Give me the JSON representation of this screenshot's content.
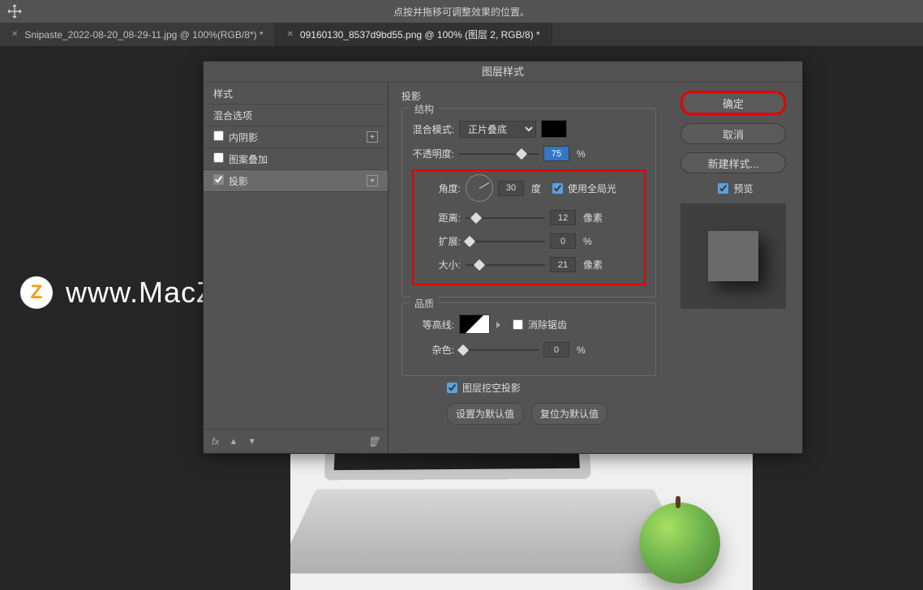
{
  "toolbar": {
    "hint": "点按并拖移可调整效果的位置。"
  },
  "tabs": [
    {
      "label": "Snipaste_2022-08-20_08-29-11.jpg @ 100%(RGB/8*) *",
      "active": false
    },
    {
      "label": "09160130_8537d9bd55.png @ 100% (图层 2, RGB/8) *",
      "active": true
    }
  ],
  "watermark": {
    "icon_letter": "Z",
    "text": "www.MacZ.com"
  },
  "dialog": {
    "title": "图层样式",
    "styles_header": "样式",
    "blend_options": "混合选项",
    "items": [
      {
        "label": "内阴影",
        "checked": false,
        "add": true
      },
      {
        "label": "图案叠加",
        "checked": false,
        "add": false
      },
      {
        "label": "投影",
        "checked": true,
        "selected": true,
        "add": true
      }
    ],
    "footer_fx": "fx",
    "section": "投影",
    "structure": {
      "legend": "结构",
      "blend_mode_label": "混合模式:",
      "blend_mode": "正片叠底",
      "opacity_label": "不透明度:",
      "opacity": "75",
      "angle_label": "角度:",
      "angle": "30",
      "angle_unit": "度",
      "global_light": "使用全局光",
      "distance_label": "距离:",
      "distance": "12",
      "px": "像素",
      "spread_label": "扩展:",
      "spread": "0",
      "size_label": "大小:",
      "size": "21"
    },
    "quality": {
      "legend": "品质",
      "contour_label": "等高线:",
      "antialias": "消除锯齿",
      "noise_label": "杂色:",
      "noise": "0"
    },
    "knockout": "图层挖空投影",
    "set_default": "设置为默认值",
    "reset_default": "复位为默认值",
    "ok": "确定",
    "cancel": "取消",
    "new_style": "新建样式...",
    "preview": "预览"
  }
}
